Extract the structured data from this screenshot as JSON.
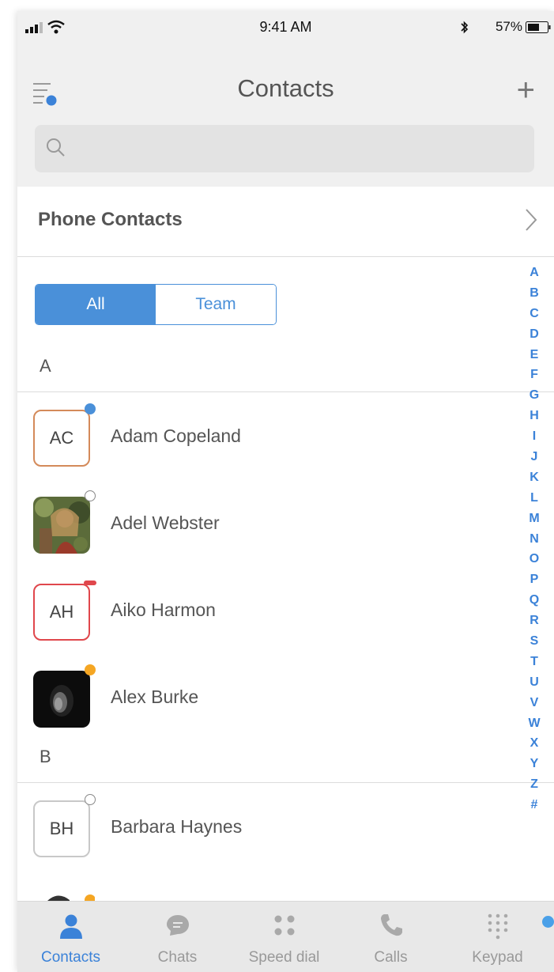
{
  "status_bar": {
    "time": "9:41 AM",
    "battery_percent": "57%"
  },
  "header": {
    "title": "Contacts",
    "add_label": "+"
  },
  "search": {
    "placeholder": "",
    "value": ""
  },
  "phone_contacts": {
    "label": "Phone Contacts"
  },
  "filter": {
    "options": [
      "All",
      "Team"
    ],
    "selected": "All"
  },
  "alphabet": [
    "A",
    "B",
    "C",
    "D",
    "E",
    "F",
    "G",
    "H",
    "I",
    "J",
    "K",
    "L",
    "M",
    "N",
    "O",
    "P",
    "Q",
    "R",
    "S",
    "T",
    "U",
    "V",
    "W",
    "X",
    "Y",
    "Z",
    "#"
  ],
  "sections": [
    {
      "letter": "A",
      "contacts": [
        {
          "name": "Adam Copeland",
          "initials": "AC",
          "avatar": "initials",
          "status": "available",
          "status_color": "#4a90d9",
          "ring_color": "#d48a5a"
        },
        {
          "name": "Adel Webster",
          "initials": "",
          "avatar": "photo",
          "status": "offline",
          "status_color": "#ffffff",
          "ring_color": ""
        },
        {
          "name": "Aiko Harmon",
          "initials": "AH",
          "avatar": "initials",
          "status": "busy",
          "status_color": "#e0474c",
          "ring_color": "#e0474c"
        },
        {
          "name": "Alex Burke",
          "initials": "",
          "avatar": "photo",
          "status": "away",
          "status_color": "#f5a623",
          "ring_color": ""
        }
      ]
    },
    {
      "letter": "B",
      "contacts": [
        {
          "name": "Barbara Haynes",
          "initials": "BH",
          "avatar": "initials",
          "status": "offline",
          "status_color": "#ffffff",
          "ring_color": "#c8c8c8"
        }
      ]
    }
  ],
  "tabs": [
    {
      "label": "Contacts",
      "icon": "person-icon",
      "active": true
    },
    {
      "label": "Chats",
      "icon": "chat-bubble-icon",
      "active": false
    },
    {
      "label": "Speed dial",
      "icon": "speed-dial-dots-icon",
      "active": false
    },
    {
      "label": "Calls",
      "icon": "phone-handset-icon",
      "active": false
    },
    {
      "label": "Keypad",
      "icon": "keypad-icon",
      "active": false
    }
  ],
  "colors": {
    "accent": "#3b82d8",
    "header_bg": "#f0f0f0"
  }
}
